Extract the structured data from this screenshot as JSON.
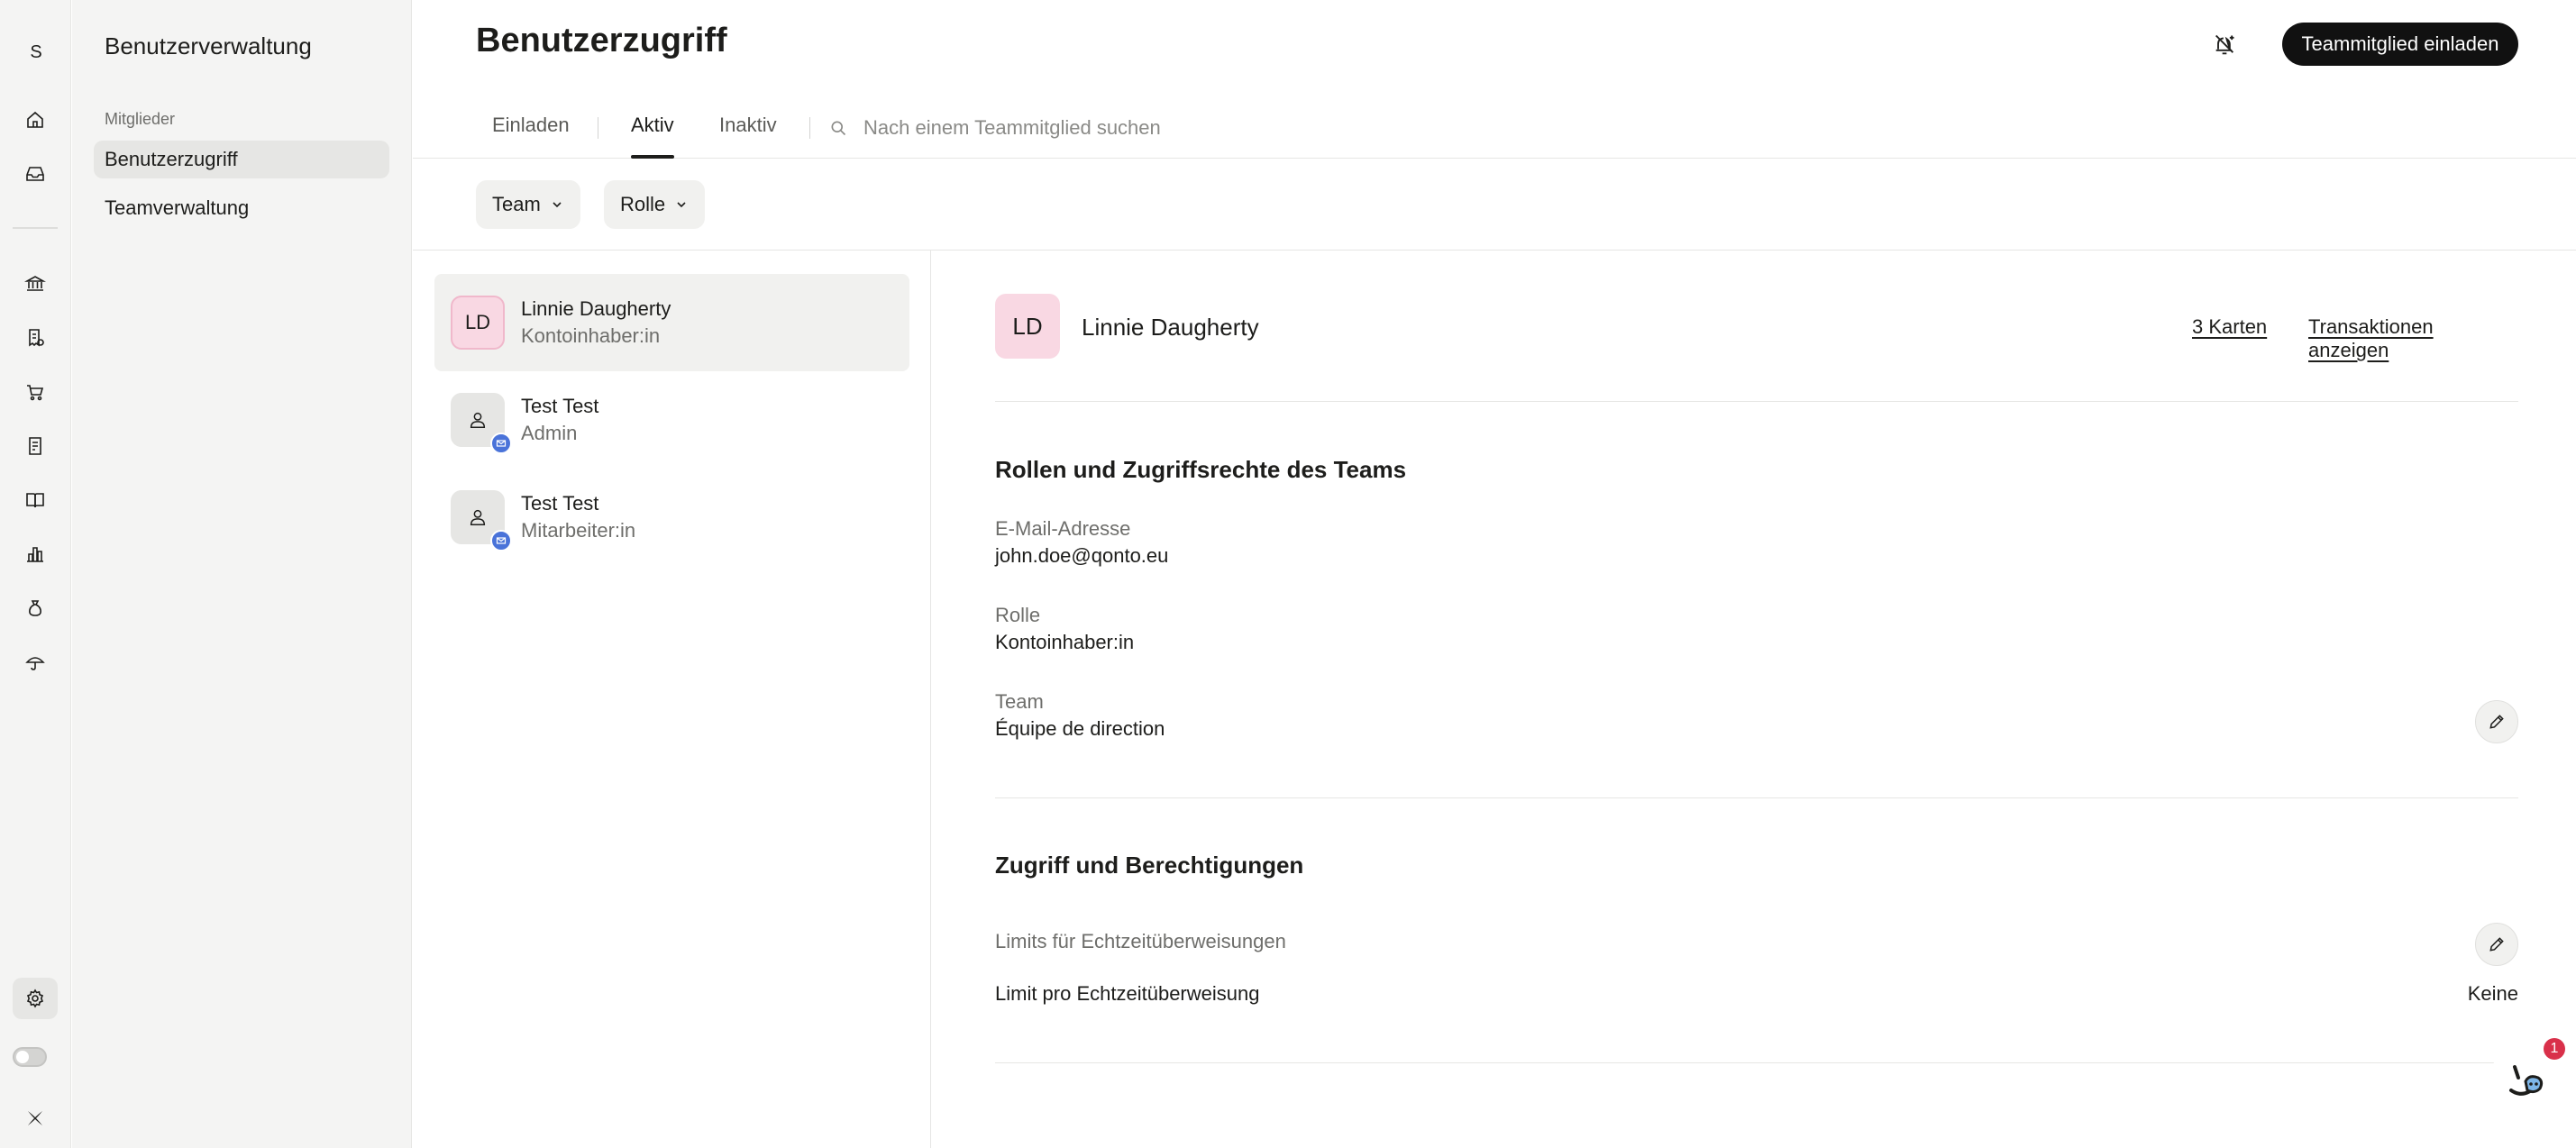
{
  "rail": {
    "avatar_letter": "S",
    "icons": [
      "home-icon",
      "inbox-icon",
      "bank-icon",
      "receipt-icon",
      "cart-icon",
      "invoice-icon",
      "book-icon",
      "analytics-icon",
      "savings-icon",
      "insurance-icon",
      "settings-icon",
      "theme-toggle",
      "brand-logo"
    ]
  },
  "sidebar": {
    "title": "Benutzerverwaltung",
    "section_label": "Mitglieder",
    "items": [
      {
        "label": "Benutzerzugriff",
        "active": true
      },
      {
        "label": "Teamverwaltung",
        "active": false
      }
    ]
  },
  "header": {
    "title": "Benutzerzugriff",
    "invite_button": "Teammitglied einladen"
  },
  "tabs": [
    {
      "label": "Einladen",
      "active": false
    },
    {
      "label": "Aktiv",
      "active": true
    },
    {
      "label": "Inaktiv",
      "active": false
    }
  ],
  "search": {
    "placeholder": "Nach einem Teammitglied suchen",
    "value": ""
  },
  "filters": {
    "team": "Team",
    "role": "Rolle"
  },
  "members": [
    {
      "initials": "LD",
      "name": "Linnie Daugherty",
      "role": "Kontoinhaber:in",
      "selected": true
    },
    {
      "initials": "",
      "name": "Test Test",
      "role": "Admin",
      "selected": false,
      "pending_invite": true
    },
    {
      "initials": "",
      "name": "Test Test",
      "role": "Mitarbeiter:in",
      "selected": false,
      "pending_invite": true
    }
  ],
  "detail": {
    "initials": "LD",
    "name": "Linnie Daugherty",
    "cards_link": "3 Karten",
    "transactions_link": "Transaktionen anzeigen",
    "roles_heading": "Rollen und Zugriffsrechte des Teams",
    "email_label": "E-Mail-Adresse",
    "email_value": "john.doe@qonto.eu",
    "role_label": "Rolle",
    "role_value": "Kontoinhaber:in",
    "team_label": "Team",
    "team_value": "Équipe de direction",
    "access_heading": "Zugriff und Berechtigungen",
    "limits_label": "Limits für Echtzeitüberweisungen",
    "limit_per_transfer_label": "Limit pro Echtzeitüberweisung",
    "limit_per_transfer_value": "Keine"
  },
  "chat": {
    "badge_count": "1"
  },
  "colors": {
    "accent": "#111111",
    "avatar_pink": "#f9d8e3",
    "mail_badge": "#4a73d9",
    "notification_red": "#d9304a"
  }
}
